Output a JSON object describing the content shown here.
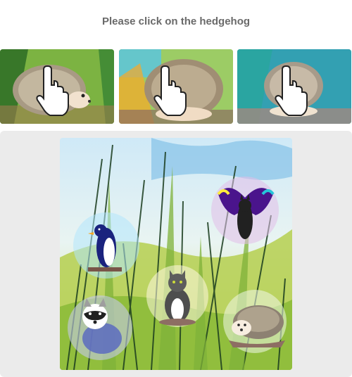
{
  "prompt": {
    "title": "Please click on the hedgehog"
  },
  "examples": [
    {
      "subject": "hedgehog",
      "cursor": "hand-pointer-icon"
    },
    {
      "subject": "hedgehog",
      "cursor": "hand-pointer-icon"
    },
    {
      "subject": "hedgehog",
      "cursor": "hand-pointer-icon"
    }
  ],
  "challenge": {
    "options": [
      "penguin",
      "bat",
      "cat",
      "raccoon",
      "hedgehog"
    ]
  },
  "colors": {
    "panel": "#ebebeb",
    "title": "#6a6a6a"
  }
}
